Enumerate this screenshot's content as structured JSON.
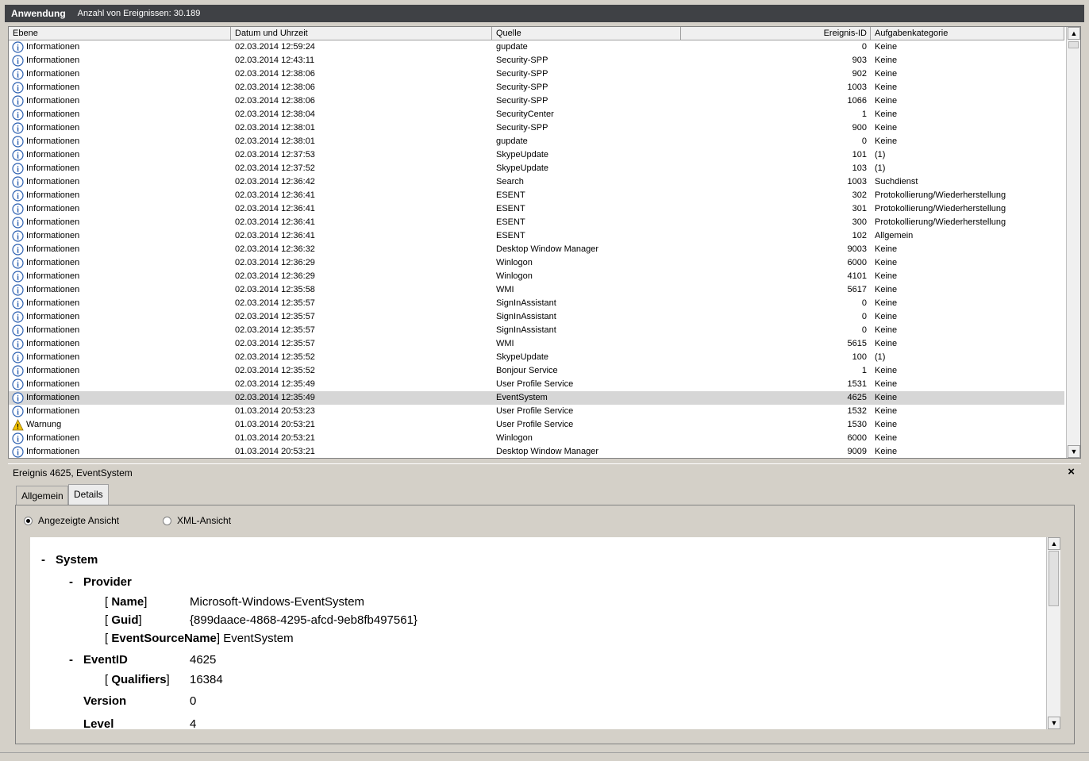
{
  "title": {
    "main": "Anwendung",
    "count": "Anzahl von Ereignissen: 30.189"
  },
  "columns": [
    "Ebene",
    "Datum und Uhrzeit",
    "Quelle",
    "Ereignis-ID",
    "Aufgabenkategorie"
  ],
  "rows": [
    {
      "level": "Informationen",
      "icon": "info-icon",
      "date": "02.03.2014 12:59:24",
      "source": "gupdate",
      "id": "0",
      "category": "Keine"
    },
    {
      "level": "Informationen",
      "icon": "info-icon",
      "date": "02.03.2014 12:43:11",
      "source": "Security-SPP",
      "id": "903",
      "category": "Keine"
    },
    {
      "level": "Informationen",
      "icon": "info-icon",
      "date": "02.03.2014 12:38:06",
      "source": "Security-SPP",
      "id": "902",
      "category": "Keine"
    },
    {
      "level": "Informationen",
      "icon": "info-icon",
      "date": "02.03.2014 12:38:06",
      "source": "Security-SPP",
      "id": "1003",
      "category": "Keine"
    },
    {
      "level": "Informationen",
      "icon": "info-icon",
      "date": "02.03.2014 12:38:06",
      "source": "Security-SPP",
      "id": "1066",
      "category": "Keine"
    },
    {
      "level": "Informationen",
      "icon": "info-icon",
      "date": "02.03.2014 12:38:04",
      "source": "SecurityCenter",
      "id": "1",
      "category": "Keine"
    },
    {
      "level": "Informationen",
      "icon": "info-icon",
      "date": "02.03.2014 12:38:01",
      "source": "Security-SPP",
      "id": "900",
      "category": "Keine"
    },
    {
      "level": "Informationen",
      "icon": "info-icon",
      "date": "02.03.2014 12:38:01",
      "source": "gupdate",
      "id": "0",
      "category": "Keine"
    },
    {
      "level": "Informationen",
      "icon": "info-icon",
      "date": "02.03.2014 12:37:53",
      "source": "SkypeUpdate",
      "id": "101",
      "category": "(1)"
    },
    {
      "level": "Informationen",
      "icon": "info-icon",
      "date": "02.03.2014 12:37:52",
      "source": "SkypeUpdate",
      "id": "103",
      "category": "(1)"
    },
    {
      "level": "Informationen",
      "icon": "info-icon",
      "date": "02.03.2014 12:36:42",
      "source": "Search",
      "id": "1003",
      "category": "Suchdienst"
    },
    {
      "level": "Informationen",
      "icon": "info-icon",
      "date": "02.03.2014 12:36:41",
      "source": "ESENT",
      "id": "302",
      "category": "Protokollierung/Wiederherstellung"
    },
    {
      "level": "Informationen",
      "icon": "info-icon",
      "date": "02.03.2014 12:36:41",
      "source": "ESENT",
      "id": "301",
      "category": "Protokollierung/Wiederherstellung"
    },
    {
      "level": "Informationen",
      "icon": "info-icon",
      "date": "02.03.2014 12:36:41",
      "source": "ESENT",
      "id": "300",
      "category": "Protokollierung/Wiederherstellung"
    },
    {
      "level": "Informationen",
      "icon": "info-icon",
      "date": "02.03.2014 12:36:41",
      "source": "ESENT",
      "id": "102",
      "category": "Allgemein"
    },
    {
      "level": "Informationen",
      "icon": "info-icon",
      "date": "02.03.2014 12:36:32",
      "source": "Desktop Window Manager",
      "id": "9003",
      "category": "Keine"
    },
    {
      "level": "Informationen",
      "icon": "info-icon",
      "date": "02.03.2014 12:36:29",
      "source": "Winlogon",
      "id": "6000",
      "category": "Keine"
    },
    {
      "level": "Informationen",
      "icon": "info-icon",
      "date": "02.03.2014 12:36:29",
      "source": "Winlogon",
      "id": "4101",
      "category": "Keine"
    },
    {
      "level": "Informationen",
      "icon": "info-icon",
      "date": "02.03.2014 12:35:58",
      "source": "WMI",
      "id": "5617",
      "category": "Keine"
    },
    {
      "level": "Informationen",
      "icon": "info-icon",
      "date": "02.03.2014 12:35:57",
      "source": "SignInAssistant",
      "id": "0",
      "category": "Keine"
    },
    {
      "level": "Informationen",
      "icon": "info-icon",
      "date": "02.03.2014 12:35:57",
      "source": "SignInAssistant",
      "id": "0",
      "category": "Keine"
    },
    {
      "level": "Informationen",
      "icon": "info-icon",
      "date": "02.03.2014 12:35:57",
      "source": "SignInAssistant",
      "id": "0",
      "category": "Keine"
    },
    {
      "level": "Informationen",
      "icon": "info-icon",
      "date": "02.03.2014 12:35:57",
      "source": "WMI",
      "id": "5615",
      "category": "Keine"
    },
    {
      "level": "Informationen",
      "icon": "info-icon",
      "date": "02.03.2014 12:35:52",
      "source": "SkypeUpdate",
      "id": "100",
      "category": "(1)"
    },
    {
      "level": "Informationen",
      "icon": "info-icon",
      "date": "02.03.2014 12:35:52",
      "source": "Bonjour Service",
      "id": "1",
      "category": "Keine"
    },
    {
      "level": "Informationen",
      "icon": "info-icon",
      "date": "02.03.2014 12:35:49",
      "source": "User Profile Service",
      "id": "1531",
      "category": "Keine"
    },
    {
      "level": "Informationen",
      "icon": "info-icon",
      "date": "02.03.2014 12:35:49",
      "source": "EventSystem",
      "id": "4625",
      "category": "Keine",
      "selected": true
    },
    {
      "level": "Informationen",
      "icon": "info-icon",
      "date": "01.03.2014 20:53:23",
      "source": "User Profile Service",
      "id": "1532",
      "category": "Keine"
    },
    {
      "level": "Warnung",
      "icon": "warning-icon",
      "date": "01.03.2014 20:53:21",
      "source": "User Profile Service",
      "id": "1530",
      "category": "Keine"
    },
    {
      "level": "Informationen",
      "icon": "info-icon",
      "date": "01.03.2014 20:53:21",
      "source": "Winlogon",
      "id": "6000",
      "category": "Keine"
    },
    {
      "level": "Informationen",
      "icon": "info-icon",
      "date": "01.03.2014 20:53:21",
      "source": "Desktop Window Manager",
      "id": "9009",
      "category": "Keine"
    }
  ],
  "detail": {
    "title": "Ereignis 4625, EventSystem",
    "close": "×",
    "tabs": [
      "Allgemein",
      "Details"
    ],
    "active_tab": "Details",
    "radio_friendly": "Angezeigte Ansicht",
    "radio_xml": "XML-Ansicht",
    "tree": {
      "system_toggle": "-",
      "system": "System",
      "provider_toggle": "-",
      "provider": "Provider",
      "name_key": "Name",
      "name_val": "Microsoft-Windows-EventSystem",
      "guid_key": "Guid",
      "guid_val": "{899daace-4868-4295-afcd-9eb8fb497561}",
      "esn_key": "EventSourceName",
      "esn_val": "EventSystem",
      "eventid_toggle": "-",
      "eventid_key": "EventID",
      "eventid_val": "4625",
      "qualifiers_key": "Qualifiers",
      "qualifiers_val": "16384",
      "version_key": "Version",
      "version_val": "0",
      "level_key": "Level",
      "level_val": "4"
    }
  },
  "colors": {
    "titlebar": "#3f4145",
    "selected_row": "#d6d6d6",
    "info_icon": "#2b5fb0",
    "warning_icon": "#f2c200"
  }
}
